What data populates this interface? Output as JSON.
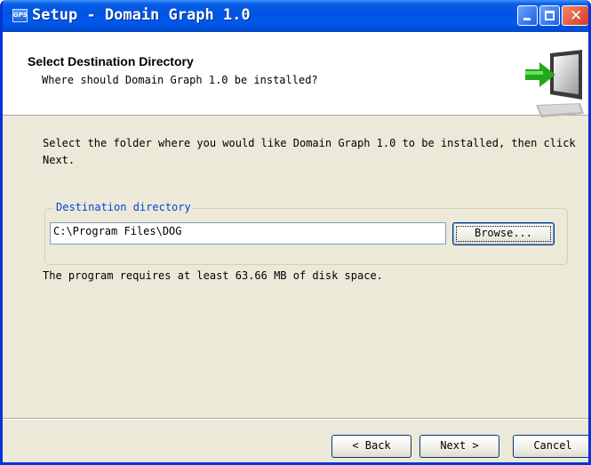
{
  "window": {
    "title": "Setup - Domain Graph 1.0",
    "app_icon_text": "GPS"
  },
  "header": {
    "title": "Select Destination Directory",
    "subtitle": "Where should Domain Graph 1.0 be installed?"
  },
  "content": {
    "intro": "Select the folder where you would like Domain Graph 1.0 to be installed, then click Next.",
    "group_label": "Destination directory",
    "directory_value": "C:\\Program Files\\DOG",
    "browse_label": "Browse...",
    "space_text": "The program requires at least 63.66 MB of disk space."
  },
  "footer": {
    "back_label": "< Back",
    "next_label": "Next >",
    "cancel_label": "Cancel"
  },
  "colors": {
    "title_bar": "#0054e3",
    "window_bg": "#ece9d8",
    "group_label": "#0046d5"
  },
  "icons": [
    "setup-app-icon",
    "minimize-icon",
    "maximize-icon",
    "close-icon",
    "computer-arrow-icon"
  ]
}
